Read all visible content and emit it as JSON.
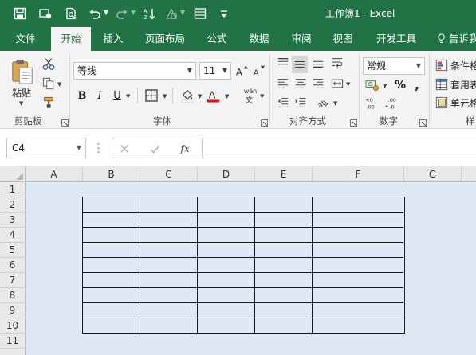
{
  "window": {
    "title": "工作簿1  -  Excel"
  },
  "quick_access": [
    "save-icon",
    "touch-mode-icon",
    "print-preview-icon",
    "undo-icon",
    "redo-icon",
    "sort-icon",
    "shapes-icon",
    "form-icon",
    "customize-qat-icon"
  ],
  "tabs": [
    {
      "label": "文件",
      "active": false
    },
    {
      "label": "开始",
      "active": true
    },
    {
      "label": "插入",
      "active": false
    },
    {
      "label": "页面布局",
      "active": false
    },
    {
      "label": "公式",
      "active": false
    },
    {
      "label": "数据",
      "active": false
    },
    {
      "label": "审阅",
      "active": false
    },
    {
      "label": "视图",
      "active": false
    },
    {
      "label": "开发工具",
      "active": false
    },
    {
      "label": "告诉我",
      "active": false
    }
  ],
  "ribbon": {
    "clipboard": {
      "paste_label": "粘贴",
      "group_label": "剪贴板"
    },
    "font": {
      "font_name": "等线",
      "font_size": "11",
      "group_label": "字体",
      "phonetic": "wén"
    },
    "alignment": {
      "group_label": "对齐方式"
    },
    "number": {
      "format": "常规",
      "group_label": "数字"
    },
    "styles": {
      "conditional_format": "条件格",
      "table_format": "套用表",
      "cell_styles": "单元格",
      "group_label": "样"
    }
  },
  "formula_bar": {
    "name_box": "C4",
    "fx_label": "fx",
    "formula_value": ""
  },
  "sheet": {
    "columns": [
      "A",
      "B",
      "C",
      "D",
      "E",
      "F",
      "G"
    ],
    "rows": [
      "1",
      "2",
      "3",
      "4",
      "5",
      "6",
      "7",
      "8",
      "9",
      "10",
      "11"
    ],
    "selected_cell": "C4",
    "bordered_range": "B2:F10"
  },
  "colors": {
    "accent": "#217346",
    "grid_background": "#dfe9f5",
    "font_color_bar": "#e01010"
  }
}
